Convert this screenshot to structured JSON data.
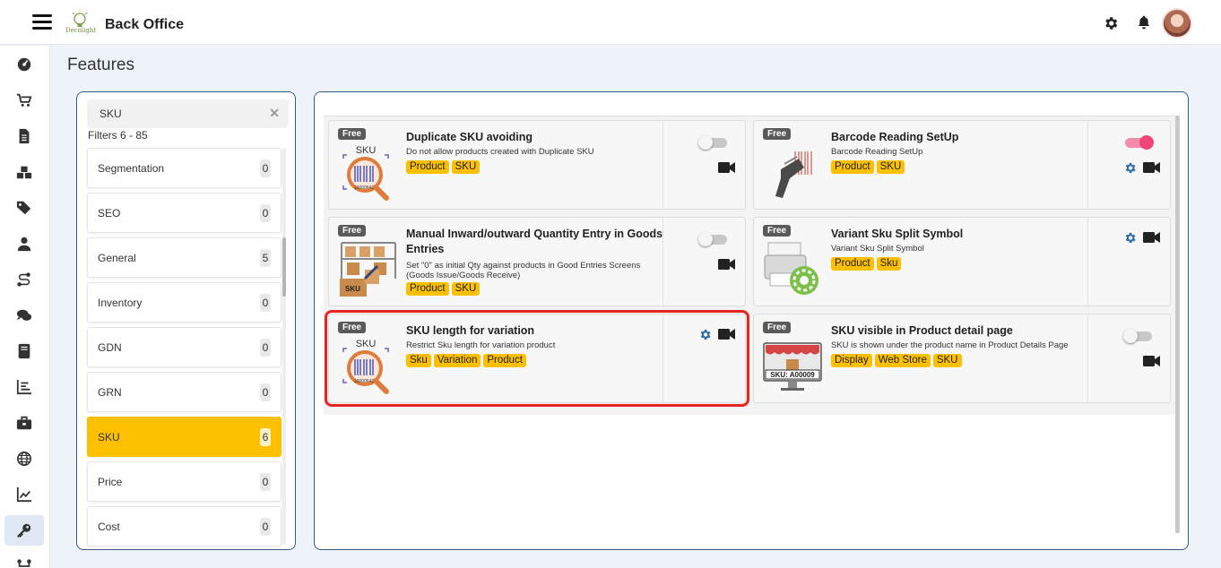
{
  "app": {
    "title": "Back Office",
    "logo_text": "Decolight"
  },
  "page": {
    "title": "Features"
  },
  "sidebar": {
    "items": [
      {
        "icon": "dashboard-icon"
      },
      {
        "icon": "cart-icon"
      },
      {
        "icon": "document-icon"
      },
      {
        "icon": "boxes-icon"
      },
      {
        "icon": "tags-icon"
      },
      {
        "icon": "user-icon"
      },
      {
        "icon": "route-icon"
      },
      {
        "icon": "chat-icon"
      },
      {
        "icon": "book-icon"
      },
      {
        "icon": "list-chart-icon"
      },
      {
        "icon": "briefcase-icon"
      },
      {
        "icon": "globe-icon"
      },
      {
        "icon": "line-chart-icon"
      },
      {
        "icon": "key-icon",
        "active": true
      },
      {
        "icon": "flow-icon"
      }
    ]
  },
  "filters": {
    "search_value": "SKU",
    "count_text": "Filters 6 - 85",
    "items": [
      {
        "label": "Segmentation",
        "count": "0"
      },
      {
        "label": "SEO",
        "count": "0"
      },
      {
        "label": "General",
        "count": "5"
      },
      {
        "label": "Inventory",
        "count": "0"
      },
      {
        "label": "GDN",
        "count": "0"
      },
      {
        "label": "GRN",
        "count": "0"
      },
      {
        "label": "SKU",
        "count": "6",
        "active": true
      },
      {
        "label": "Price",
        "count": "0"
      },
      {
        "label": "Cost",
        "count": "0"
      }
    ]
  },
  "features": [
    {
      "badge": "Free",
      "title": "Duplicate SKU avoiding",
      "description": "Do not allow products created with Duplicate SKU",
      "tags": [
        "Product",
        "SKU"
      ],
      "toggle": "off",
      "has_settings": false,
      "image": "sku-magnifier",
      "image_label": "SKU"
    },
    {
      "badge": "Free",
      "title": "Barcode Reading SetUp",
      "description": "Barcode Reading SetUp",
      "tags": [
        "Product",
        "SKU"
      ],
      "toggle": "on",
      "has_settings": true,
      "image": "barcode-scanner"
    },
    {
      "badge": "Free",
      "title": "Manual Inward/outward Quantity Entry in Goods Entries",
      "description": "Set \"0\" as initial Qty against products in Good Entries Screens (Goods Issue/Goods Receive)",
      "tags": [
        "Product",
        "SKU"
      ],
      "toggle": "off",
      "has_settings": false,
      "image": "warehouse-boxes",
      "image_label": "SKU"
    },
    {
      "badge": "Free",
      "title": "Variant Sku Split Symbol",
      "description": "Variant Sku Split Symbol",
      "tags": [
        "Product",
        "Sku"
      ],
      "toggle": null,
      "has_settings": true,
      "image": "printer-gear"
    },
    {
      "badge": "Free",
      "title": "SKU length for variation",
      "description": "Restrict Sku length for variation product",
      "tags": [
        "Sku",
        "Variation",
        "Product"
      ],
      "toggle": null,
      "has_settings": true,
      "highlighted": true,
      "image": "sku-magnifier",
      "image_label": "SKU"
    },
    {
      "badge": "Free",
      "title": "SKU visible in Product detail page",
      "description": "SKU is shown under the product name in Product Details Page",
      "tags": [
        "Display",
        "Web Store",
        "SKU"
      ],
      "toggle": "off",
      "has_settings": false,
      "image": "store-monitor",
      "image_label": "SKU: A00009"
    }
  ],
  "colors": {
    "accent": "#fcc000",
    "toggle_on": "#f1457a",
    "settings_icon": "#2f6fb0",
    "highlight": "#e52424",
    "panel_border": "#2e5d8a"
  }
}
